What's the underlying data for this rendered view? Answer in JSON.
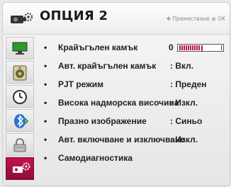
{
  "header": {
    "title": "ОПЦИЯ 2",
    "hint_move": "Преместване",
    "hint_ok": "OK",
    "icon": "settings-projector-icon"
  },
  "sidebar": {
    "items": [
      {
        "icon": "monitor-icon",
        "active": false
      },
      {
        "icon": "speaker-icon",
        "active": false
      },
      {
        "icon": "clock-icon",
        "active": false
      },
      {
        "icon": "bluetooth-icon",
        "active": false
      },
      {
        "icon": "lock-icon",
        "active": false
      },
      {
        "icon": "option-settings-icon",
        "active": true
      }
    ]
  },
  "menu": {
    "rows": [
      {
        "label": "Крайъгълен камък",
        "value": "0",
        "type": "slider",
        "level": 0
      },
      {
        "label": "Авт. крайъгълен камък",
        "value": ": Вкл.",
        "type": "text"
      },
      {
        "label": "PJT режим",
        "value": ": Преден",
        "type": "text"
      },
      {
        "label": "Висока надморска височина",
        "value": ": Изкл.",
        "type": "text"
      },
      {
        "label": "Празно изображение",
        "value": ": Синьо",
        "type": "text"
      },
      {
        "label": "Авт. включване и изключване",
        "value": ": Изкл.",
        "type": "text"
      },
      {
        "label": "Самодиагностика",
        "value": "",
        "type": "text"
      }
    ]
  },
  "colors": {
    "accent": "#c0154f",
    "text": "#202020"
  }
}
